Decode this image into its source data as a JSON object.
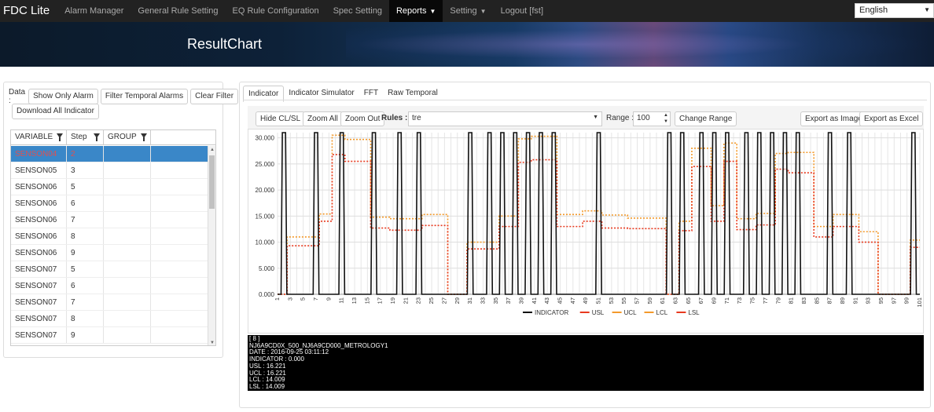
{
  "nav": {
    "brand": "FDC Lite",
    "items": [
      "Alarm Manager",
      "General Rule Setting",
      "EQ Rule Configuration",
      "Spec Setting",
      "Reports",
      "Setting",
      "Logout [fst]"
    ],
    "language": "English"
  },
  "banner": {
    "title": "ResultChart"
  },
  "left": {
    "data_label": "Data :",
    "btn_show_only_alarm": "Show Only Alarm",
    "btn_filter_temporal": "Filter Temporal Alarms",
    "btn_clear_filter": "Clear Filter",
    "btn_download_all": "Download All Indicator",
    "columns": [
      "VARIABLE",
      "Step",
      "GROUP"
    ],
    "rows": [
      {
        "variable": "SENSON04",
        "step": "2",
        "group": ""
      },
      {
        "variable": "SENSON05",
        "step": "3",
        "group": ""
      },
      {
        "variable": "SENSON06",
        "step": "5",
        "group": ""
      },
      {
        "variable": "SENSON06",
        "step": "6",
        "group": ""
      },
      {
        "variable": "SENSON06",
        "step": "7",
        "group": ""
      },
      {
        "variable": "SENSON06",
        "step": "8",
        "group": ""
      },
      {
        "variable": "SENSON06",
        "step": "9",
        "group": ""
      },
      {
        "variable": "SENSON07",
        "step": "5",
        "group": ""
      },
      {
        "variable": "SENSON07",
        "step": "6",
        "group": ""
      },
      {
        "variable": "SENSON07",
        "step": "7",
        "group": ""
      },
      {
        "variable": "SENSON07",
        "step": "8",
        "group": ""
      },
      {
        "variable": "SENSON07",
        "step": "9",
        "group": ""
      }
    ]
  },
  "right": {
    "tabs": [
      "Indicator",
      "Indicator Simulator",
      "FFT",
      "Raw Temporal"
    ],
    "btn_hide_clsl": "Hide CL/SL",
    "btn_zoom_all": "Zoom All",
    "btn_zoom_out": "Zoom Out",
    "rules_label": "Rules :",
    "rules_value": "tre",
    "range_label": "Range :",
    "range_value": "100",
    "btn_change_range": "Change Range",
    "btn_export_image": "Export as Image",
    "btn_export_excel": "Export as Excel",
    "info_lines": [
      "[ 8 ]",
      "NJ6A9CD0X_500_NJ6A9CD000_METROLOGY1",
      "DATE : 2016-09-25 03:11:12",
      "INDICATOR : 0.000",
      "USL : 16.221",
      "UCL : 16.221",
      "LCL : 14.009",
      "LSL : 14.009"
    ]
  },
  "chart_data": {
    "type": "line",
    "ylim": [
      0,
      31
    ],
    "yticks": [
      "0.000",
      "5.000",
      "10.000",
      "15.000",
      "20.000",
      "25.000",
      "30.000"
    ],
    "xlim": [
      1,
      101
    ],
    "xticks": [
      1,
      3,
      5,
      7,
      9,
      11,
      13,
      15,
      17,
      19,
      21,
      23,
      25,
      27,
      29,
      31,
      33,
      35,
      37,
      39,
      41,
      43,
      45,
      47,
      49,
      51,
      53,
      55,
      57,
      59,
      61,
      63,
      65,
      67,
      69,
      71,
      73,
      75,
      77,
      79,
      81,
      83,
      85,
      87,
      89,
      91,
      93,
      95,
      97,
      99,
      101
    ],
    "series_colors": {
      "INDICATOR": "#111111",
      "USL": "#e83a1f",
      "UCL": "#f39a2b",
      "LCL": "#f39a2b",
      "LSL": "#e83a1f"
    },
    "legend": [
      "INDICATOR",
      "USL",
      "UCL",
      "LCL",
      "LSL"
    ],
    "indicator_spikes": [
      2,
      7,
      11,
      16,
      20,
      23,
      31,
      34,
      36,
      38,
      40,
      42,
      44,
      51,
      62,
      64,
      67,
      69,
      71,
      74,
      76,
      78,
      80,
      82,
      87,
      90,
      100
    ],
    "ucl_segments": [
      [
        1,
        2,
        0
      ],
      [
        3,
        7,
        11
      ],
      [
        8,
        9,
        15.4
      ],
      [
        10,
        11,
        30.5
      ],
      [
        12,
        15,
        29.7
      ],
      [
        16,
        18,
        14.8
      ],
      [
        19,
        23,
        14.5
      ],
      [
        24,
        27,
        15.3
      ],
      [
        28,
        30,
        0
      ],
      [
        31,
        35,
        10
      ],
      [
        36,
        38,
        15
      ],
      [
        39,
        40,
        29.8
      ],
      [
        41,
        44,
        30.3
      ],
      [
        45,
        48,
        15.3
      ],
      [
        49,
        51,
        16
      ],
      [
        52,
        55,
        15.2
      ],
      [
        56,
        61,
        14.6
      ],
      [
        62,
        63,
        0
      ],
      [
        64,
        65,
        14
      ],
      [
        66,
        68,
        28
      ],
      [
        69,
        70,
        17
      ],
      [
        71,
        72,
        29
      ],
      [
        73,
        75,
        14.5
      ],
      [
        76,
        78,
        15.5
      ],
      [
        79,
        80,
        27
      ],
      [
        81,
        84,
        27.2
      ],
      [
        85,
        87,
        13
      ],
      [
        88,
        91,
        15.3
      ],
      [
        92,
        94,
        12
      ],
      [
        95,
        99,
        0
      ],
      [
        100,
        101,
        10.4
      ]
    ],
    "lcl_segments": [
      [
        1,
        2,
        0
      ],
      [
        3,
        7,
        9.3
      ],
      [
        8,
        9,
        14
      ],
      [
        10,
        11,
        26.8
      ],
      [
        12,
        15,
        25.5
      ],
      [
        16,
        18,
        12.7
      ],
      [
        19,
        23,
        12.3
      ],
      [
        24,
        27,
        13.2
      ],
      [
        28,
        30,
        0
      ],
      [
        31,
        35,
        8.7
      ],
      [
        36,
        38,
        13
      ],
      [
        39,
        40,
        25.3
      ],
      [
        41,
        44,
        25.8
      ],
      [
        45,
        48,
        13
      ],
      [
        49,
        51,
        14
      ],
      [
        52,
        55,
        12.7
      ],
      [
        56,
        61,
        12.6
      ],
      [
        62,
        63,
        0
      ],
      [
        64,
        65,
        12.2
      ],
      [
        66,
        68,
        24.5
      ],
      [
        69,
        70,
        14
      ],
      [
        71,
        72,
        25.5
      ],
      [
        73,
        75,
        12.4
      ],
      [
        76,
        78,
        13.3
      ],
      [
        79,
        80,
        24
      ],
      [
        81,
        84,
        23.3
      ],
      [
        85,
        87,
        11
      ],
      [
        88,
        91,
        13
      ],
      [
        92,
        94,
        10
      ],
      [
        95,
        99,
        0
      ],
      [
        100,
        101,
        9
      ]
    ]
  }
}
